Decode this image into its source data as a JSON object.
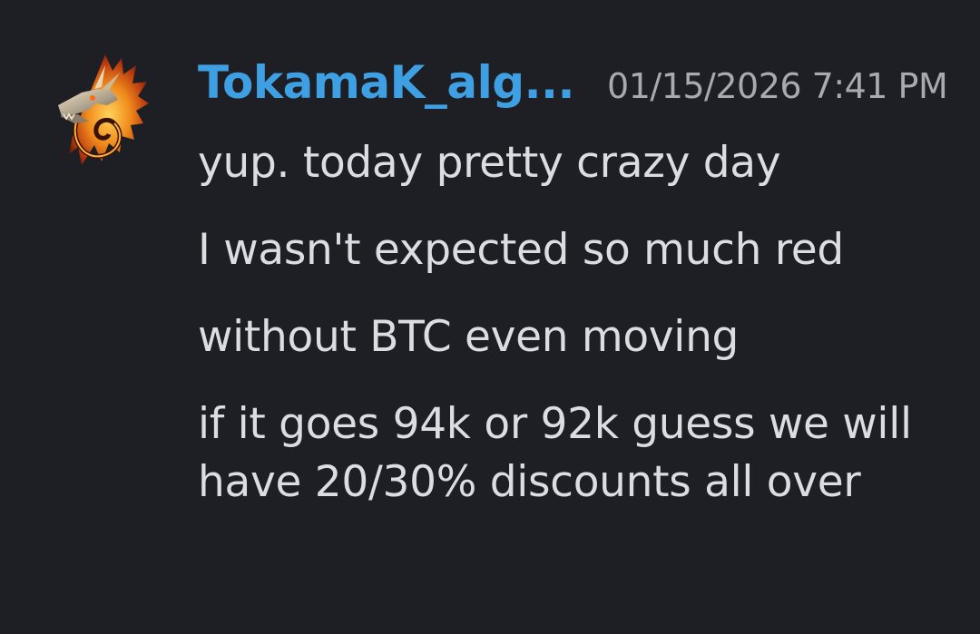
{
  "message": {
    "author": {
      "username": "TokamaK_alg...",
      "avatar_icon": "dragon-avatar-icon",
      "name_color": "#3ea0e3"
    },
    "timestamp": "01/15/2026 7:41 PM",
    "lines": [
      "yup. today pretty crazy day",
      "I wasn't expected so much red",
      "without BTC even moving",
      "if it goes 94k or 92k guess we will have 20/30% discounts all over"
    ]
  },
  "theme": {
    "background": "#1e1f24",
    "text": "#dcdde1",
    "muted": "#a7aab1"
  }
}
